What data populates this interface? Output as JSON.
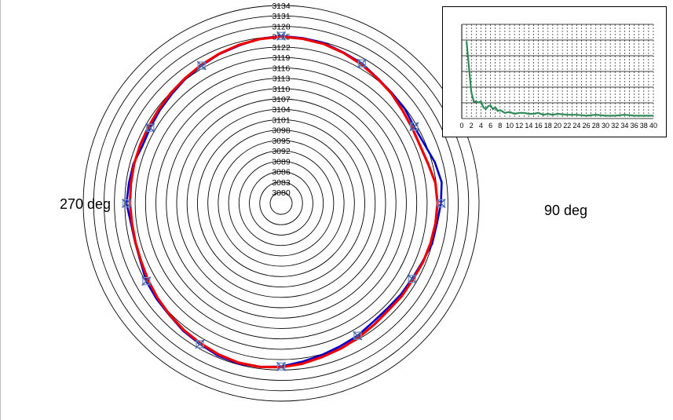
{
  "chart_data": [
    {
      "type": "polar",
      "radial_ticks": [
        "3080",
        "3083",
        "3086",
        "3089",
        "3092",
        "3095",
        "3098",
        "3101",
        "3104",
        "3107",
        "3110",
        "3113",
        "3116",
        "3119",
        "3122",
        "3125",
        "3128",
        "3131",
        "3134"
      ],
      "rlim": [
        3080,
        3134
      ],
      "angle_labels": [
        {
          "text": "270 deg",
          "angle": 270
        },
        {
          "text": "90 deg",
          "angle": 90
        }
      ],
      "series": [
        {
          "color": "#0000cc",
          "marker": "x",
          "angles": [
            0,
            7.5,
            15,
            22.5,
            30,
            37.5,
            45,
            52.5,
            60,
            67.5,
            75,
            82.5,
            90,
            97.5,
            105,
            112.5,
            120,
            127.5,
            135,
            142.5,
            150,
            157.5,
            165,
            172.5,
            180,
            187.5,
            195,
            202.5,
            210,
            217.5,
            225,
            232.5,
            240,
            247.5,
            255,
            262.5,
            270,
            277.5,
            285,
            292.5,
            300,
            307.5,
            315,
            322.5,
            330,
            337.5,
            345,
            352.5
          ],
          "values": [
            3125.2,
            3125.0,
            3124.8,
            3124.0,
            3123.5,
            3122.5,
            3122.0,
            3121.8,
            3121.2,
            3121.6,
            3122.8,
            3123.6,
            3123.0,
            3122.2,
            3122.0,
            3121.0,
            3120.5,
            3120.3,
            3120.0,
            3120.2,
            3121.0,
            3121.5,
            3122.2,
            3123.0,
            3124.0,
            3124.5,
            3124.8,
            3124.5,
            3123.8,
            3123.3,
            3122.5,
            3122.2,
            3121.8,
            3120.8,
            3120.5,
            3120.6,
            3121.5,
            3121.2,
            3121.0,
            3120.2,
            3120.5,
            3121.0,
            3121.5,
            3122.2,
            3122.8,
            3123.5,
            3124.0,
            3124.8
          ],
          "marked_angles": [
            0,
            30,
            60,
            90,
            120,
            150,
            180,
            210,
            240,
            270,
            300,
            330
          ]
        },
        {
          "color": "#ee0000",
          "marker": "none",
          "angles": [
            0,
            7.5,
            15,
            22.5,
            30,
            37.5,
            45,
            52.5,
            60,
            67.5,
            75,
            82.5,
            90,
            97.5,
            105,
            112.5,
            120,
            127.5,
            135,
            142.5,
            150,
            157.5,
            165,
            172.5,
            180,
            187.5,
            195,
            202.5,
            210,
            217.5,
            225,
            232.5,
            240,
            247.5,
            255,
            262.5,
            270,
            277.5,
            285,
            292.5,
            300,
            307.5,
            315,
            322.5,
            330,
            337.5,
            345,
            352.5
          ],
          "values": [
            3125.0,
            3124.8,
            3124.5,
            3123.9,
            3123.2,
            3122.4,
            3121.8,
            3121.0,
            3120.5,
            3120.3,
            3120.8,
            3121.8,
            3122.0,
            3121.8,
            3121.5,
            3121.2,
            3120.8,
            3120.8,
            3120.6,
            3121.0,
            3121.6,
            3122.2,
            3122.8,
            3123.6,
            3124.2,
            3124.5,
            3124.5,
            3124.1,
            3123.5,
            3123.0,
            3122.4,
            3121.8,
            3121.2,
            3120.6,
            3120.4,
            3120.3,
            3120.5,
            3120.6,
            3120.8,
            3120.9,
            3121.1,
            3121.4,
            3121.9,
            3122.4,
            3123.0,
            3123.6,
            3124.2,
            3124.7
          ]
        }
      ]
    },
    {
      "type": "line",
      "x_ticks": [
        "0",
        "2",
        "4",
        "6",
        "8",
        "10",
        "12",
        "14",
        "16",
        "18",
        "20",
        "22",
        "24",
        "26",
        "28",
        "30",
        "32",
        "34",
        "36",
        "38",
        "40"
      ],
      "xlim": [
        0,
        40
      ],
      "ylim": [
        0,
        1
      ],
      "grid": true,
      "series": [
        {
          "color": "#2e8b57",
          "x": [
            1,
            1.5,
            2,
            2.5,
            3,
            3.5,
            4,
            4.5,
            5,
            5.5,
            6,
            6.5,
            7,
            7.5,
            8,
            9,
            10,
            11,
            12,
            13,
            14,
            15,
            16,
            17,
            18,
            19,
            20,
            22,
            24,
            26,
            28,
            30,
            32,
            34,
            36,
            38,
            40
          ],
          "values": [
            0.82,
            0.55,
            0.28,
            0.18,
            0.18,
            0.17,
            0.18,
            0.12,
            0.1,
            0.13,
            0.14,
            0.1,
            0.12,
            0.08,
            0.09,
            0.06,
            0.07,
            0.05,
            0.06,
            0.06,
            0.05,
            0.05,
            0.06,
            0.04,
            0.05,
            0.04,
            0.05,
            0.04,
            0.04,
            0.03,
            0.04,
            0.03,
            0.03,
            0.04,
            0.03,
            0.03,
            0.03
          ]
        }
      ]
    }
  ]
}
